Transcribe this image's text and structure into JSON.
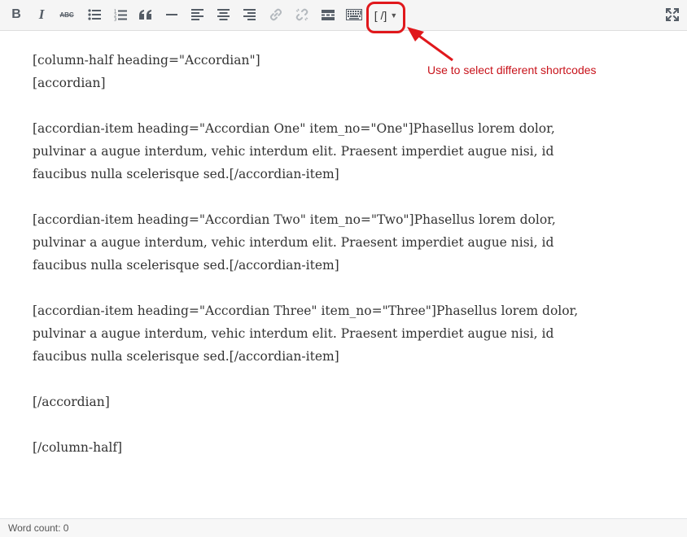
{
  "toolbar": {
    "buttons": [
      {
        "name": "bold",
        "icon": "bold-icon"
      },
      {
        "name": "italic",
        "icon": "italic-icon"
      },
      {
        "name": "strikethrough",
        "icon": "strikethrough-icon",
        "label": "ABC"
      },
      {
        "name": "bulleted-list",
        "icon": "bulleted-list-icon"
      },
      {
        "name": "numbered-list",
        "icon": "numbered-list-icon"
      },
      {
        "name": "blockquote",
        "icon": "blockquote-icon"
      },
      {
        "name": "horizontal-line",
        "icon": "horizontal-line-icon"
      },
      {
        "name": "align-left",
        "icon": "align-left-icon"
      },
      {
        "name": "align-center",
        "icon": "align-center-icon"
      },
      {
        "name": "align-right",
        "icon": "align-right-icon"
      },
      {
        "name": "insert-link",
        "icon": "link-icon"
      },
      {
        "name": "remove-link",
        "icon": "unlink-icon"
      },
      {
        "name": "read-more",
        "icon": "read-more-icon"
      },
      {
        "name": "toolbar-toggle",
        "icon": "keyboard-icon"
      },
      {
        "name": "fullscreen",
        "icon": "fullscreen-icon"
      }
    ],
    "shortcode_label": "[ /]",
    "shortcode_caret": "▼"
  },
  "annotation": {
    "text": "Use to select different shortcodes",
    "color": "#c8121a"
  },
  "content": {
    "lines": [
      "[column-half heading=\"Accordian\"]\n[accordian]",
      "[accordian-item heading=\"Accordian One\" item_no=\"One\"]Phasellus lorem dolor, pulvinar a augue interdum, vehic interdum elit. Praesent imperdiet augue nisi, id faucibus nulla scelerisque sed.[/accordian-item]",
      "[accordian-item heading=\"Accordian Two\" item_no=\"Two\"]Phasellus lorem dolor, pulvinar a augue interdum, vehic interdum elit. Praesent imperdiet augue nisi, id faucibus nulla scelerisque sed.[/accordian-item]",
      "[accordian-item heading=\"Accordian Three\" item_no=\"Three\"]Phasellus lorem dolor, pulvinar a augue interdum, vehic interdum elit. Praesent imperdiet augue nisi, id faucibus nulla scelerisque sed.[/accordian-item]",
      "[/accordian]",
      "[/column-half]"
    ]
  },
  "footer": {
    "word_count_label": "Word count: 0"
  }
}
